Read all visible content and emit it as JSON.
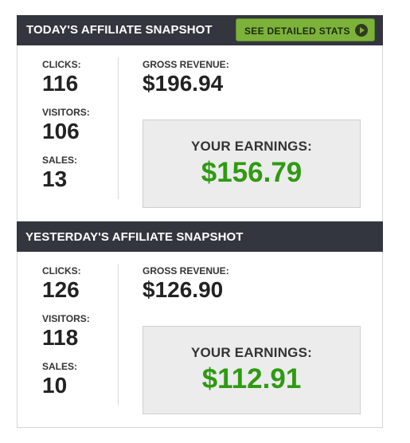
{
  "today": {
    "title": "TODAY'S AFFILIATE SNAPSHOT",
    "stats_button_label": "SEE DETAILED STATS",
    "clicks_label": "CLICKS:",
    "clicks_value": "116",
    "visitors_label": "VISITORS:",
    "visitors_value": "106",
    "sales_label": "SALES:",
    "sales_value": "13",
    "gross_label": "GROSS REVENUE:",
    "gross_value": "$196.94",
    "earnings_label": "YOUR EARNINGS:",
    "earnings_value": "$156.79"
  },
  "yesterday": {
    "title": "YESTERDAY'S AFFILIATE SNAPSHOT",
    "clicks_label": "CLICKS:",
    "clicks_value": "126",
    "visitors_label": "VISITORS:",
    "visitors_value": "118",
    "sales_label": "SALES:",
    "sales_value": "10",
    "gross_label": "GROSS REVENUE:",
    "gross_value": "$126.90",
    "earnings_label": "YOUR EARNINGS:",
    "earnings_value": "$112.91"
  },
  "colors": {
    "header_bg": "#33363f",
    "button_bg": "#7db23a",
    "earnings_green": "#2f9a12",
    "earnings_box_bg": "#ececec"
  },
  "icons": {
    "stats_button_icon": "play-circle-icon"
  }
}
